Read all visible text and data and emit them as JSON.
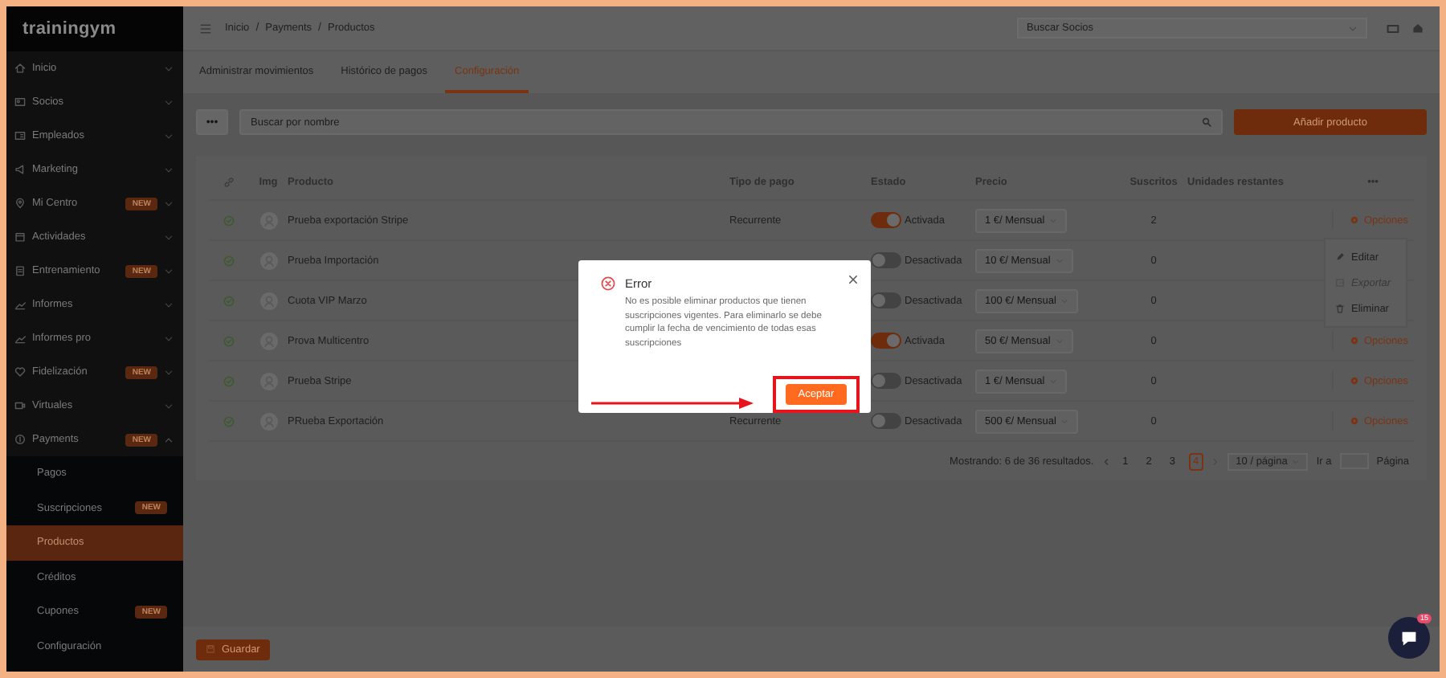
{
  "logo": "trainingym",
  "sidebar": {
    "items": [
      {
        "label": "Inicio",
        "expanded": false
      },
      {
        "label": "Socios",
        "expanded": false
      },
      {
        "label": "Empleados",
        "expanded": false
      },
      {
        "label": "Marketing",
        "expanded": false
      },
      {
        "label": "Mi Centro",
        "badge": "NEW",
        "expanded": false
      },
      {
        "label": "Actividades",
        "expanded": false
      },
      {
        "label": "Entrenamiento",
        "badge": "NEW",
        "expanded": false
      },
      {
        "label": "Informes",
        "expanded": false
      },
      {
        "label": "Informes pro",
        "expanded": false
      },
      {
        "label": "Fidelización",
        "badge": "NEW",
        "expanded": false
      },
      {
        "label": "Virtuales",
        "expanded": false
      },
      {
        "label": "Payments",
        "badge": "NEW",
        "expanded": true,
        "children": [
          {
            "label": "Pagos",
            "selected": false
          },
          {
            "label": "Suscripciones",
            "badge": "NEW",
            "selected": false
          },
          {
            "label": "Productos",
            "selected": true
          },
          {
            "label": "Créditos",
            "selected": false
          },
          {
            "label": "Cupones",
            "badge": "NEW",
            "selected": false
          },
          {
            "label": "Configuración",
            "selected": false
          }
        ]
      }
    ]
  },
  "breadcrumb": [
    {
      "kind": "link",
      "text": "Inicio"
    },
    {
      "kind": "separator",
      "text": "/"
    },
    {
      "kind": "link",
      "text": "Payments"
    },
    {
      "kind": "separator",
      "text": "/"
    },
    {
      "kind": "link",
      "text": "Productos"
    }
  ],
  "member_search": {
    "placeholder": "Buscar Socios"
  },
  "tabs": [
    {
      "label": "Administrar movimientos",
      "selected": false
    },
    {
      "label": "Histórico de pagos",
      "selected": false
    },
    {
      "label": "Configuración",
      "selected": true
    }
  ],
  "toolbar": {
    "more": "•••",
    "search": {
      "placeholder": "Buscar por nombre"
    },
    "add_button": "Añadir producto"
  },
  "table": {
    "columns": [
      "Img",
      "Producto",
      "Tipo de pago",
      "Estado",
      "Precio",
      "Suscritos",
      "Unidades restantes",
      "•••"
    ],
    "rows": [
      {
        "producto": "Prueba exportación Stripe",
        "tipo_de_pago": "Recurrente",
        "on": true,
        "estado": "Activada",
        "precio": "1 €/ Mensual",
        "suscritos": "2",
        "opciones": "Opciones"
      },
      {
        "producto": "Prueba Importación",
        "on": false,
        "estado": "Desactivada",
        "precio": "10 €/ Mensual",
        "suscritos": "0"
      },
      {
        "producto": "Cuota VIP Marzo",
        "on": false,
        "estado": "Desactivada",
        "precio": "100 €/ Mensual",
        "suscritos": "0"
      },
      {
        "producto": "Prova Multicentro",
        "on": true,
        "estado": "Activada",
        "precio": "50 €/ Mensual",
        "suscritos": "0",
        "opciones": "Opciones"
      },
      {
        "producto": "Prueba Stripe",
        "on": false,
        "estado": "Desactivada",
        "precio": "1 €/ Mensual",
        "suscritos": "0",
        "opciones": "Opciones"
      },
      {
        "producto": "PRueba Exportación",
        "tipo_de_pago": "Recurrente",
        "on": false,
        "estado": "Desactivada",
        "precio": "500 €/ Mensual",
        "suscritos": "0",
        "opciones": "Opciones"
      }
    ]
  },
  "options_menu": [
    {
      "label": "Editar",
      "disabled": false
    },
    {
      "label": "Exportar",
      "disabled": true
    },
    {
      "label": "Eliminar",
      "disabled": false
    }
  ],
  "pagination": {
    "summary": "Mostrando: 6 de 36 resultados.",
    "pages": [
      {
        "label": "1",
        "selected": false
      },
      {
        "label": "2",
        "selected": false
      },
      {
        "label": "3",
        "selected": false
      },
      {
        "label": "4",
        "selected": true
      }
    ],
    "page_size": "10 / página",
    "goto": "Ir a",
    "page_label": "Página"
  },
  "save_button": "Guardar",
  "chat": {
    "badge": "15"
  },
  "dialog": {
    "title": "Error",
    "message": "No es posible eliminar productos que tienen suscripciones vigentes. Para eliminarlo se debe cumplir la fecha de vencimiento de todas esas suscripciones",
    "ok_button": "Aceptar"
  }
}
